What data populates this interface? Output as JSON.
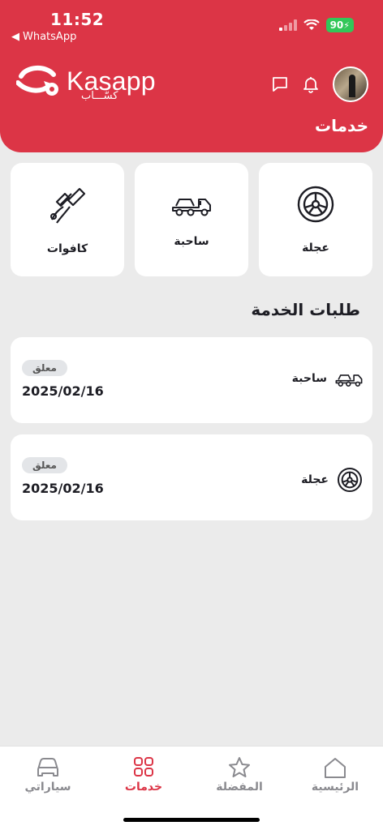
{
  "status_bar": {
    "time": "11:52",
    "back_app": "WhatsApp",
    "battery": "90"
  },
  "header": {
    "brand": "Kasapp",
    "brand_arabic": "كسّـــاب",
    "title": "خدمات",
    "icons": [
      "chat-icon",
      "bell-icon"
    ]
  },
  "services": [
    {
      "label": "عجلة",
      "icon": "tire-icon"
    },
    {
      "label": "ساحبة",
      "icon": "tow-truck-icon"
    },
    {
      "label": "كافوات",
      "icon": "jumper-cables-icon"
    }
  ],
  "requests_section": {
    "title": "طلبات الخدمة",
    "items": [
      {
        "type": "ساحبة",
        "icon": "tow-truck-icon",
        "status": "معلق",
        "date": "2025/02/16"
      },
      {
        "type": "عجلة",
        "icon": "tire-icon",
        "status": "معلق",
        "date": "2025/02/16"
      }
    ]
  },
  "nav": {
    "items": [
      {
        "label": "الرئيسية",
        "icon": "home-icon"
      },
      {
        "label": "المفضلة",
        "icon": "star-icon"
      },
      {
        "label": "خدمات",
        "icon": "grid-icon",
        "active": true
      },
      {
        "label": "سياراتي",
        "icon": "car-icon"
      }
    ]
  },
  "colors": {
    "brand_red": "#dc3546",
    "battery_green": "#32c759"
  }
}
